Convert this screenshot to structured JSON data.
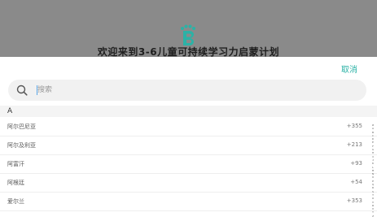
{
  "header": {
    "welcome": "欢迎来到3-6儿童可持续学习力启蒙计划"
  },
  "sheet": {
    "cancel_label": "取消",
    "search": {
      "placeholder": "搜索",
      "value": ""
    },
    "section": "A",
    "rows": [
      {
        "name": "阿尔巴尼亚",
        "code": "+355"
      },
      {
        "name": "阿尔及利亚",
        "code": "+213"
      },
      {
        "name": "阿富汗",
        "code": "+93"
      },
      {
        "name": "阿根廷",
        "code": "+54"
      },
      {
        "name": "爱尔兰",
        "code": "+353"
      }
    ],
    "index": [
      "#",
      "A",
      "B",
      "C",
      "D",
      "E",
      "F",
      "G",
      "H",
      "I",
      "J",
      "K",
      "L",
      "M",
      "N",
      "O",
      "P",
      "Q",
      "R",
      "S",
      "T",
      "U",
      "V",
      "W",
      "X",
      "Y",
      "Z"
    ]
  },
  "colors": {
    "accent": "#2bb2a6",
    "backdrop": "#8a8a8a"
  },
  "icons": {
    "logo": "paw-b-logo-icon",
    "search": "search-icon"
  }
}
